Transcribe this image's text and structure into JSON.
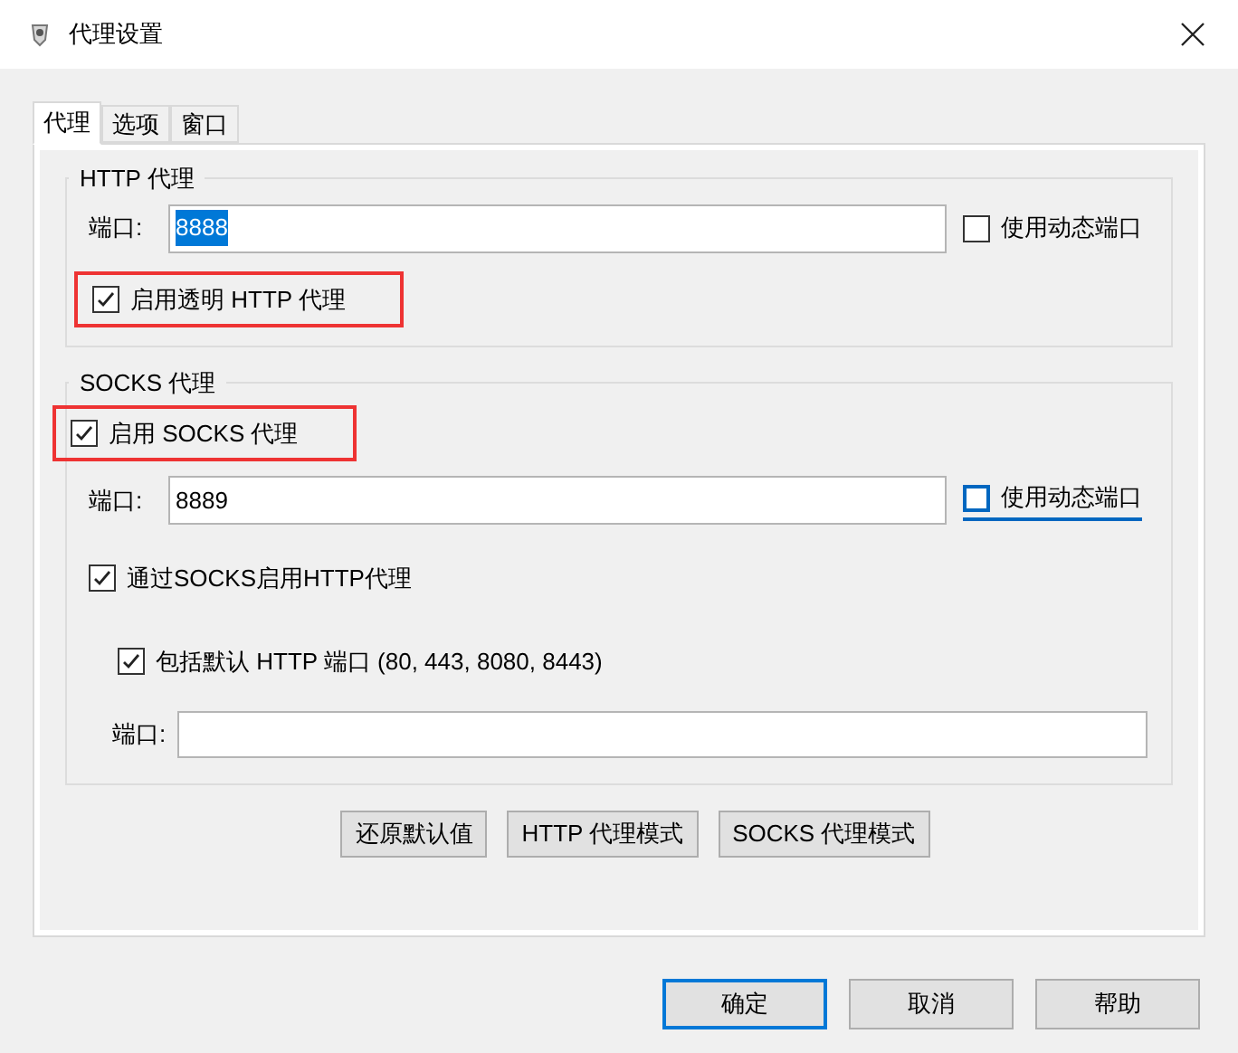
{
  "window": {
    "title": "代理设置"
  },
  "tabs": [
    {
      "label": "代理",
      "selected": true
    },
    {
      "label": "选项",
      "selected": false
    },
    {
      "label": "窗口",
      "selected": false
    }
  ],
  "http_group": {
    "title": "HTTP 代理",
    "port_label": "端口:",
    "port_value": "8888",
    "value_selected": true,
    "dynamic_port": {
      "label": "使用动态端口",
      "checked": false,
      "focused": false
    },
    "transparent": {
      "label": "启用透明 HTTP 代理",
      "checked": true,
      "highlighted": true
    }
  },
  "socks_group": {
    "title": "SOCKS 代理",
    "enable": {
      "label": "启用 SOCKS 代理",
      "checked": true,
      "highlighted": true
    },
    "port_label": "端口:",
    "port_value": "8889",
    "value_selected": false,
    "dynamic_port": {
      "label": "使用动态端口",
      "checked": false,
      "focused": true
    },
    "via_socks": {
      "label": "通过SOCKS启用HTTP代理",
      "checked": true
    },
    "include_default": {
      "label": "包括默认 HTTP 端口 (80, 443, 8080, 8443)",
      "checked": true
    },
    "extra_port_label": "端口:"
  },
  "mode_buttons": [
    "还原默认值",
    "HTTP 代理模式",
    "SOCKS 代理模式"
  ],
  "dialog_buttons": [
    {
      "label": "确定",
      "default": true
    },
    {
      "label": "取消",
      "default": false
    },
    {
      "label": "帮助",
      "default": false
    }
  ]
}
